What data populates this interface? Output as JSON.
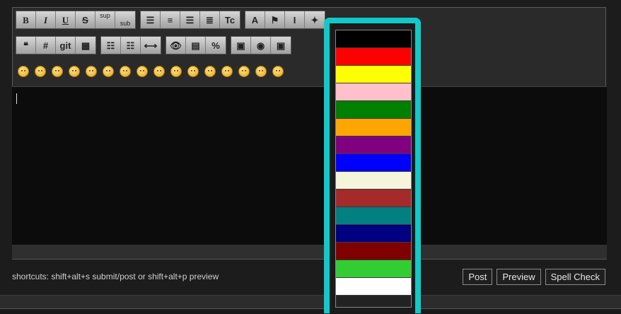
{
  "toolbar": {
    "row1_groups": [
      [
        {
          "name": "bold-button",
          "label": "B",
          "cls": "ico-b"
        },
        {
          "name": "italic-button",
          "label": "I",
          "cls": "ico-i"
        },
        {
          "name": "underline-button",
          "label": "U",
          "cls": "ico-u"
        },
        {
          "name": "strikethrough-button",
          "label": "S",
          "cls": "ico-s"
        },
        {
          "name": "superscript-button",
          "label": "sup",
          "cls": "ico-sup"
        },
        {
          "name": "subscript-button",
          "label": "sub",
          "cls": "ico-sub"
        }
      ],
      [
        {
          "name": "align-left-button",
          "label": "☰",
          "cls": ""
        },
        {
          "name": "align-center-button",
          "label": "≡",
          "cls": ""
        },
        {
          "name": "align-right-button",
          "label": "☰",
          "cls": ""
        },
        {
          "name": "justify-button",
          "label": "≣",
          "cls": ""
        },
        {
          "name": "font-button",
          "label": "Tc",
          "cls": ""
        }
      ],
      [
        {
          "name": "color-a-button",
          "label": "A",
          "cls": ""
        },
        {
          "name": "flag-button",
          "label": "⚑",
          "cls": ""
        },
        {
          "name": "highlight-button",
          "label": "I",
          "cls": ""
        },
        {
          "name": "pin-button",
          "label": "✦",
          "cls": ""
        }
      ]
    ],
    "row2_groups": [
      [
        {
          "name": "quote-button",
          "label": "❝",
          "cls": ""
        },
        {
          "name": "hash-button",
          "label": "#",
          "cls": ""
        },
        {
          "name": "git-button",
          "label": "git",
          "cls": "ico-git"
        },
        {
          "name": "table-button",
          "label": "▦",
          "cls": ""
        }
      ],
      [
        {
          "name": "bullet-list-button",
          "label": "☷",
          "cls": ""
        },
        {
          "name": "numbered-list-button",
          "label": "☷",
          "cls": ""
        },
        {
          "name": "horizontal-rule-button",
          "label": "⟷",
          "cls": ""
        }
      ],
      [
        {
          "name": "spoiler-button",
          "label": "👁",
          "cls": ""
        },
        {
          "name": "attach-button",
          "label": "▤",
          "cls": ""
        },
        {
          "name": "percent-button",
          "label": "%",
          "cls": ""
        }
      ],
      [
        {
          "name": "insert-image-button",
          "label": "▣",
          "cls": ""
        },
        {
          "name": "insert-link-button",
          "label": "◉",
          "cls": ""
        },
        {
          "name": "insert-video-button",
          "label": "▣",
          "cls": ""
        }
      ]
    ]
  },
  "smileys": [
    "smile",
    "wink",
    "grin",
    "laugh",
    "angry",
    "confused",
    "surprised",
    "cool",
    "sad",
    "tongue",
    "blush",
    "shocked",
    "cry",
    "neutral",
    "happy",
    "frown"
  ],
  "picker": {
    "colors": [
      "#000000",
      "#ff0000",
      "#ffff00",
      "#ffc0cb",
      "#008000",
      "#ffa500",
      "#800080",
      "#0000ff",
      "#f5f5dc",
      "#a52a2a",
      "#008080",
      "#000080",
      "#800000",
      "#32cd32",
      "#ffffff"
    ]
  },
  "footer": {
    "shortcuts": "shortcuts: shift+alt+s submit/post or shift+alt+p preview",
    "post": "Post",
    "preview": "Preview",
    "spell_check": "Spell Check"
  }
}
